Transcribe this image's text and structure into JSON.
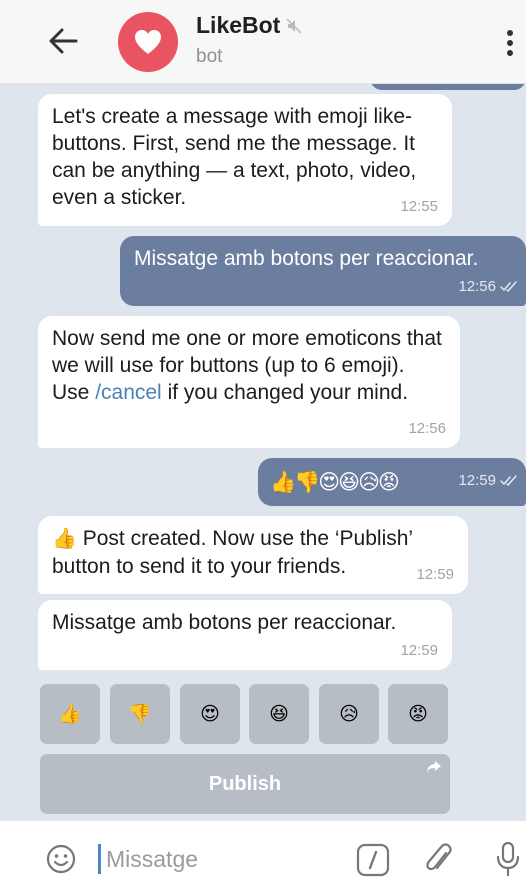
{
  "header": {
    "title": "LikeBot",
    "subtitle": "bot",
    "avatar_icon": "heart-icon",
    "accent": "#ea5462"
  },
  "messages": [
    {
      "dir": "in",
      "text": "Let's create a message with emoji like-buttons. First, send me the message. It can be anything — a text, photo, video, even a sticker.",
      "time": "12:55"
    },
    {
      "dir": "out",
      "text": "Missatge amb botons per reaccionar.",
      "time": "12:56"
    },
    {
      "dir": "in",
      "text_before": "Now send me one or more emoticons that we will use for buttons (up to 6 emoji). Use ",
      "link": "/cancel",
      "text_after": " if you changed your mind.",
      "time": "12:56"
    },
    {
      "dir": "out",
      "emoji": "👍👎😍😆😥😡",
      "time": "12:59"
    },
    {
      "dir": "in",
      "emoji_prefix": "👍",
      "text": " Post created. Now use the ‘Publish’ button to send it to your friends.",
      "time": "12:59"
    },
    {
      "dir": "in",
      "text": "Missatge amb botons per reaccionar.",
      "time": "12:59"
    }
  ],
  "keyboard": {
    "buttons": [
      "👍",
      "👎",
      "😍",
      "😆",
      "😥",
      "😡"
    ],
    "publish_label": "Publish"
  },
  "input": {
    "placeholder": "Missatge"
  },
  "colors": {
    "chat_background": "#dfe5ec",
    "outgoing_bubble": "#6b7e9f",
    "keyboard_button": "#b7bdc4",
    "link": "#4a82b3"
  }
}
